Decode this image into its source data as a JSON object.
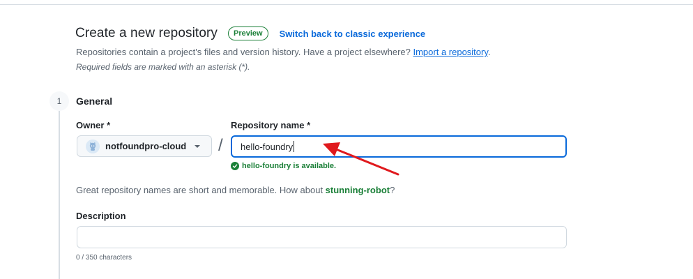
{
  "header": {
    "title": "Create a new repository",
    "badge": "Preview",
    "classic_link": "Switch back to classic experience"
  },
  "intro": {
    "text": "Repositories contain a project's files and version history. Have a project elsewhere? ",
    "import_link": "Import a repository",
    "after_link": ".",
    "required_note": "Required fields are marked with an asterisk (*)."
  },
  "step": {
    "number": "1",
    "title": "General"
  },
  "owner": {
    "label": "Owner *",
    "value": "notfoundpro-cloud",
    "icon": "octocat-avatar"
  },
  "separator": "/",
  "repo_name": {
    "label": "Repository name *",
    "value": "hello-foundry",
    "availability": "hello-foundry is available."
  },
  "suggestion": {
    "text": "Great repository names are short and memorable. How about ",
    "name": "stunning-robot",
    "suffix": "?"
  },
  "description": {
    "label": "Description",
    "value": "",
    "counter": "0 / 350 characters"
  },
  "colors": {
    "accent": "#0969da",
    "success": "#1a7f37",
    "annotation_arrow": "#e0191d"
  }
}
